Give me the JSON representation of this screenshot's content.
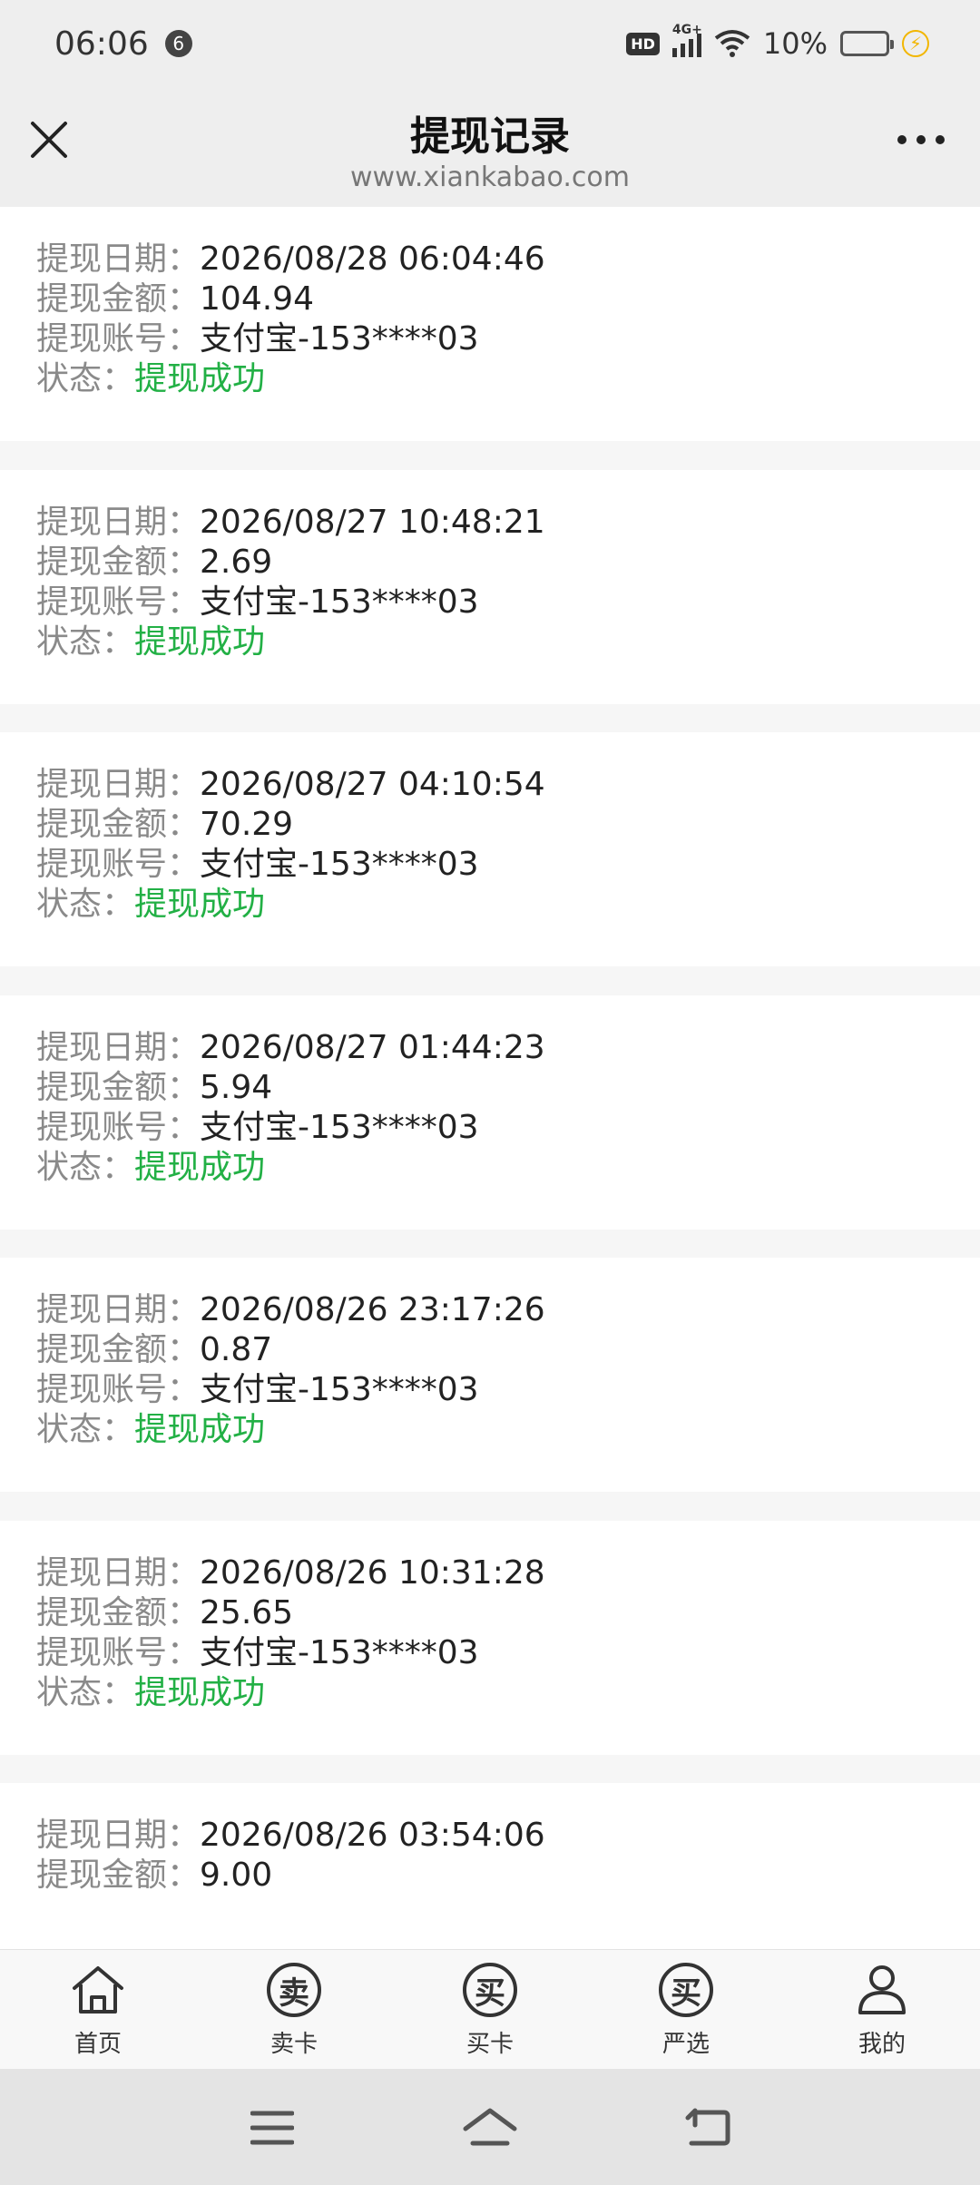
{
  "status_bar": {
    "time": "06:06",
    "notification_count": "6",
    "hd": "HD",
    "network": "4G+",
    "battery_percent": "10%",
    "battery_level": 0.1
  },
  "header": {
    "title": "提现记录",
    "subtitle": "www.xiankabao.com"
  },
  "records": [
    {
      "date_label": "提现日期：",
      "date": "2026/08/28 06:04:46",
      "amount_label": "提现金额：",
      "amount": "104.94",
      "account_label": "提现账号：",
      "account": "支付宝-153****03",
      "status_label": "状态：",
      "status": "提现成功"
    },
    {
      "date_label": "提现日期：",
      "date": "2026/08/27 10:48:21",
      "amount_label": "提现金额：",
      "amount": "2.69",
      "account_label": "提现账号：",
      "account": "支付宝-153****03",
      "status_label": "状态：",
      "status": "提现成功"
    },
    {
      "date_label": "提现日期：",
      "date": "2026/08/27 04:10:54",
      "amount_label": "提现金额：",
      "amount": "70.29",
      "account_label": "提现账号：",
      "account": "支付宝-153****03",
      "status_label": "状态：",
      "status": "提现成功"
    },
    {
      "date_label": "提现日期：",
      "date": "2026/08/27 01:44:23",
      "amount_label": "提现金额：",
      "amount": "5.94",
      "account_label": "提现账号：",
      "account": "支付宝-153****03",
      "status_label": "状态：",
      "status": "提现成功"
    },
    {
      "date_label": "提现日期：",
      "date": "2026/08/26 23:17:26",
      "amount_label": "提现金额：",
      "amount": "0.87",
      "account_label": "提现账号：",
      "account": "支付宝-153****03",
      "status_label": "状态：",
      "status": "提现成功"
    },
    {
      "date_label": "提现日期：",
      "date": "2026/08/26 10:31:28",
      "amount_label": "提现金额：",
      "amount": "25.65",
      "account_label": "提现账号：",
      "account": "支付宝-153****03",
      "status_label": "状态：",
      "status": "提现成功"
    },
    {
      "date_label": "提现日期：",
      "date": "2026/08/26 03:54:06",
      "amount_label": "提现金额：",
      "amount": "9.00"
    }
  ],
  "tabs": [
    {
      "label": "首页",
      "icon": "home-icon"
    },
    {
      "label": "卖卡",
      "glyph": "卖",
      "icon": "sell-icon"
    },
    {
      "label": "买卡",
      "glyph": "买",
      "icon": "buy-icon"
    },
    {
      "label": "严选",
      "glyph": "买",
      "icon": "select-icon"
    },
    {
      "label": "我的",
      "icon": "user-icon"
    }
  ],
  "colors": {
    "accent": "#f8b400",
    "success": "#22b045",
    "label": "#8a8a8a"
  }
}
